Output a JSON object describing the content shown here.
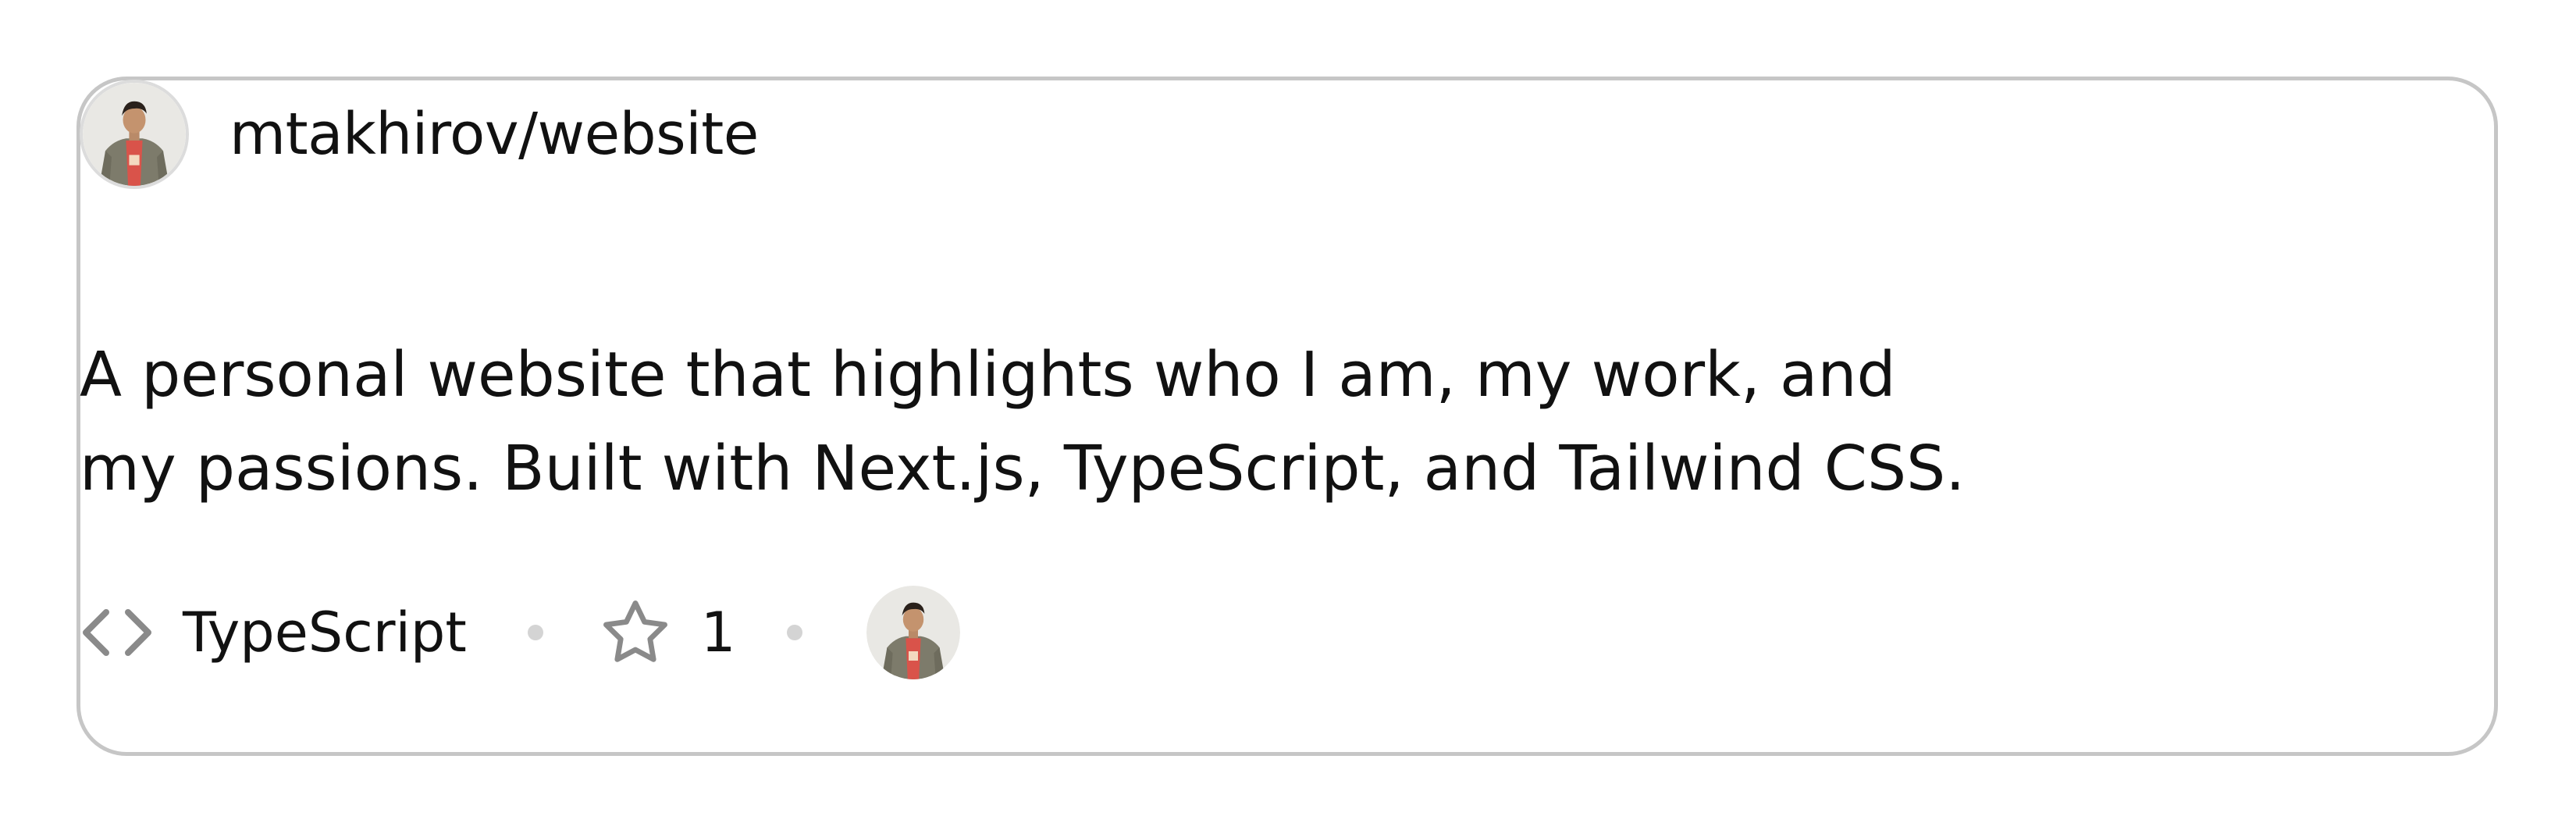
{
  "repo": {
    "full_name": "mtakhirov/website",
    "description_lines": [
      "A personal website that highlights who I am, my work, and",
      "my passions. Built with Next.js, TypeScript, and Tailwind CSS."
    ],
    "language": "TypeScript",
    "stars": "1"
  },
  "icons": {
    "language": "code-icon",
    "stars": "star-icon"
  },
  "colors": {
    "border": "#c6c6c6",
    "text": "#111111",
    "icon": "#8a8a8a",
    "separator_dot": "#d4d4d4"
  }
}
